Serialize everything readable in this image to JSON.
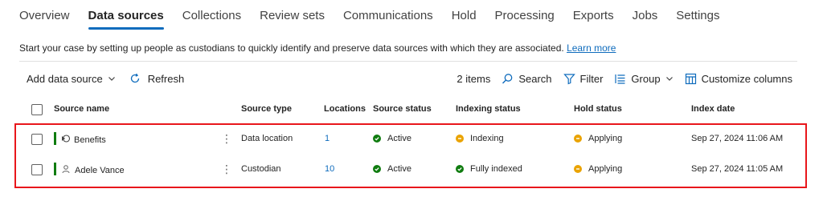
{
  "tabs": [
    "Overview",
    "Data sources",
    "Collections",
    "Review sets",
    "Communications",
    "Hold",
    "Processing",
    "Exports",
    "Jobs",
    "Settings"
  ],
  "active_tab": "Data sources",
  "intro": {
    "text": "Start your case by setting up people as custodians to quickly identify and preserve data sources with which they are associated.",
    "link": "Learn more"
  },
  "toolbar": {
    "add_data_source": "Add data source",
    "refresh": "Refresh",
    "items_count": "2 items",
    "search": "Search",
    "filter": "Filter",
    "group": "Group",
    "customize_columns": "Customize columns"
  },
  "table": {
    "columns": [
      "Source name",
      "Source type",
      "Locations",
      "Source status",
      "Indexing status",
      "Hold status",
      "Index date"
    ],
    "rows": [
      {
        "icon": "location-icon",
        "name": "Benefits",
        "source_type": "Data location",
        "locations": "1",
        "source_status": "Active",
        "indexing_status": "Indexing",
        "indexing_color": "#eaa300",
        "hold_status": "Applying",
        "index_date": "Sep 27, 2024 11:06 AM"
      },
      {
        "icon": "person-icon",
        "name": "Adele Vance",
        "source_type": "Custodian",
        "locations": "10",
        "source_status": "Active",
        "indexing_status": "Fully indexed",
        "indexing_color": "#107c10",
        "hold_status": "Applying",
        "index_date": "Sep 27, 2024 11:05 AM"
      }
    ]
  },
  "colors": {
    "accent": "#0f6cbd",
    "active_green": "#107c10",
    "pending_yellow": "#eaa300",
    "highlight_red": "#e8161b"
  }
}
